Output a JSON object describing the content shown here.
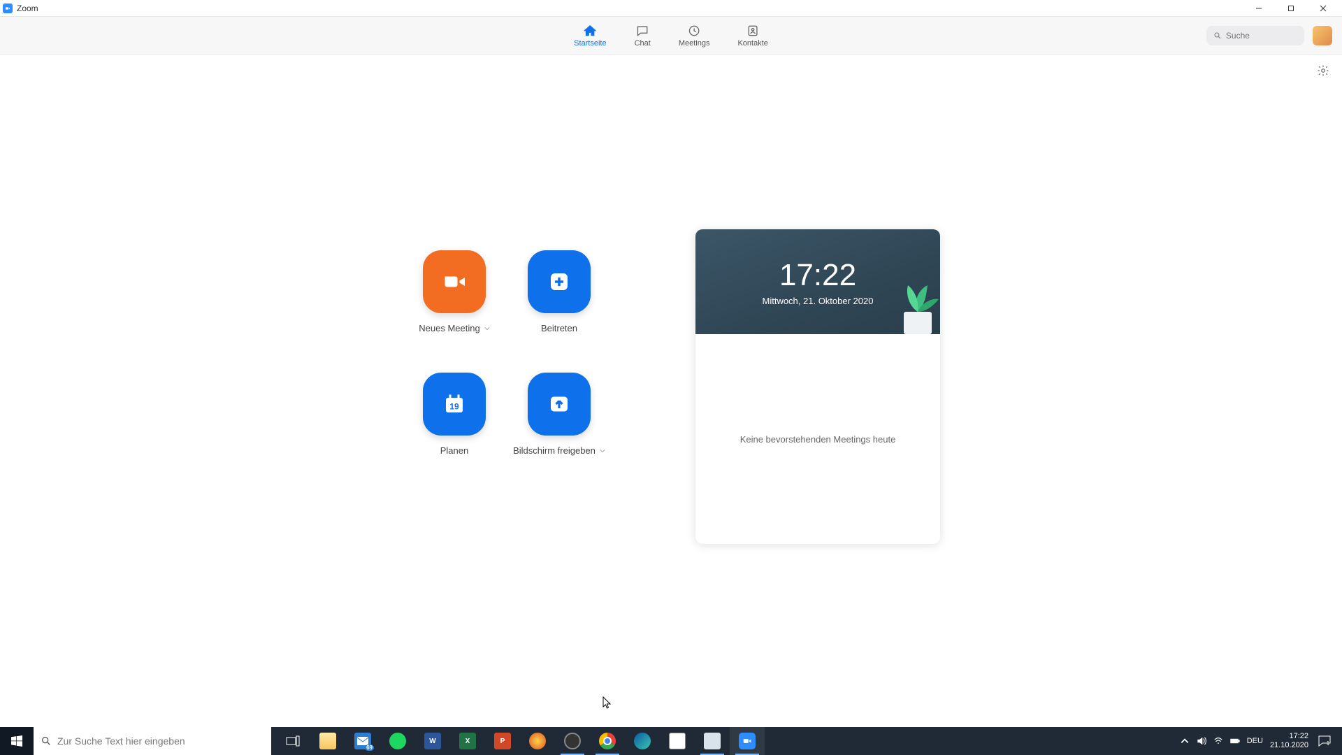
{
  "titlebar": {
    "title": "Zoom"
  },
  "nav": {
    "home": "Startseite",
    "chat": "Chat",
    "meetings": "Meetings",
    "contacts": "Kontakte"
  },
  "search": {
    "placeholder": "Suche"
  },
  "tiles": {
    "new_meeting": "Neues Meeting",
    "join": "Beitreten",
    "schedule": "Planen",
    "schedule_day": "19",
    "share_screen": "Bildschirm freigeben"
  },
  "panel": {
    "time": "17:22",
    "date": "Mittwoch, 21. Oktober 2020",
    "no_meetings": "Keine bevorstehenden Meetings heute"
  },
  "taskbar": {
    "search_placeholder": "Zur Suche Text hier eingeben",
    "mail_badge": "69",
    "lang": "DEU",
    "time": "17:22",
    "date": "21.10.2020",
    "notif_count": "1"
  }
}
